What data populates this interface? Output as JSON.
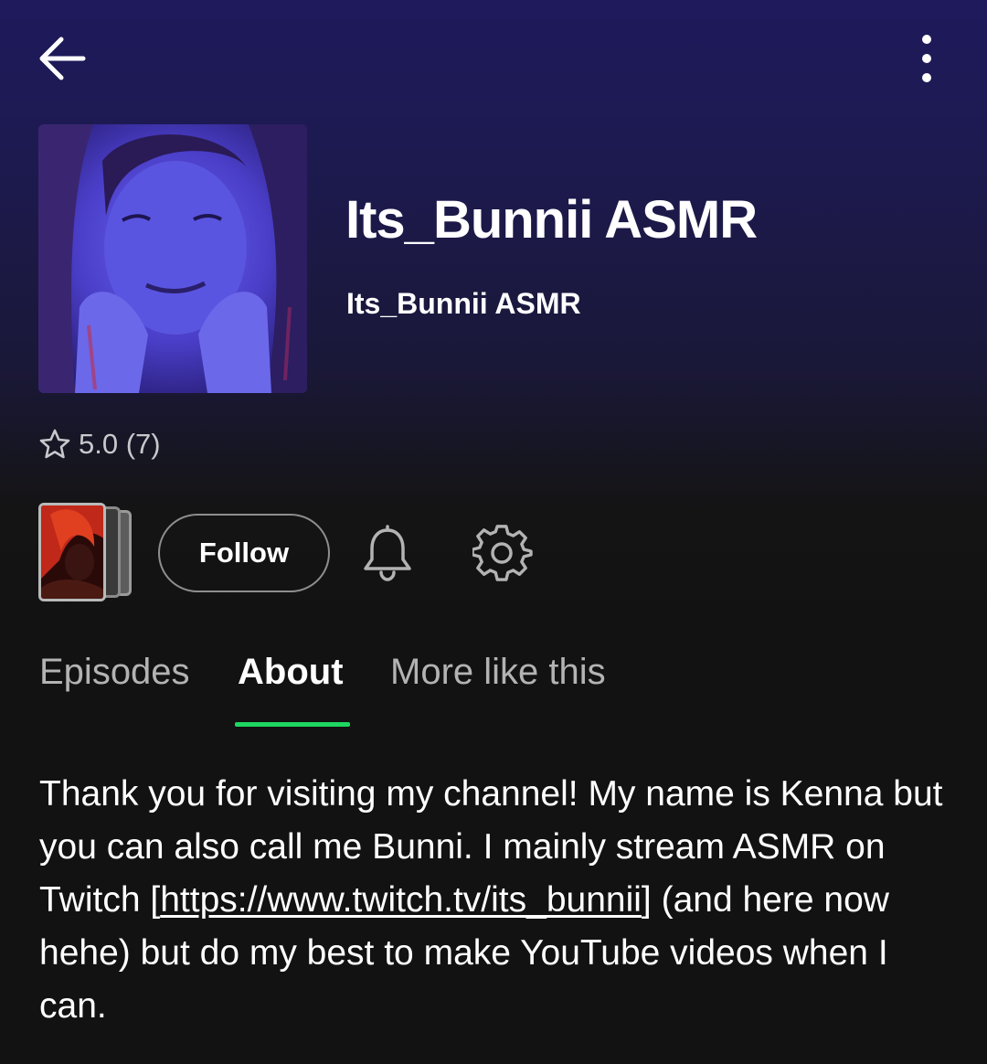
{
  "header": {
    "back_icon": "arrow-left-icon",
    "more_icon": "more-vertical-icon"
  },
  "show": {
    "title": "Its_Bunnii ASMR",
    "author": "Its_Bunnii ASMR",
    "cover_icon": "podcast-cover-image",
    "rating": {
      "icon": "star-outline-icon",
      "text": "5.0 (7)"
    }
  },
  "actions": {
    "episodes_thumb_icon": "episode-stack-thumbnail",
    "follow_label": "Follow",
    "bell_icon": "bell-icon",
    "settings_icon": "gear-icon"
  },
  "tabs": [
    {
      "label": "Episodes",
      "active": false
    },
    {
      "label": "About",
      "active": true
    },
    {
      "label": "More like this",
      "active": false
    }
  ],
  "about": {
    "text_before_link": "Thank you for visiting my channel! My name is Kenna but you can also call me Bunni. I mainly stream ASMR on Twitch [",
    "link_text": "https://www.twitch.tv/its_bunnii",
    "text_after_link": "] (and here now hehe) but do my best to make YouTube videos when I can."
  },
  "colors": {
    "header_gradient_top": "#1e1a5c",
    "background": "#121212",
    "active_tab_indicator": "#1ed760",
    "inactive_text": "#b3b3b3"
  }
}
